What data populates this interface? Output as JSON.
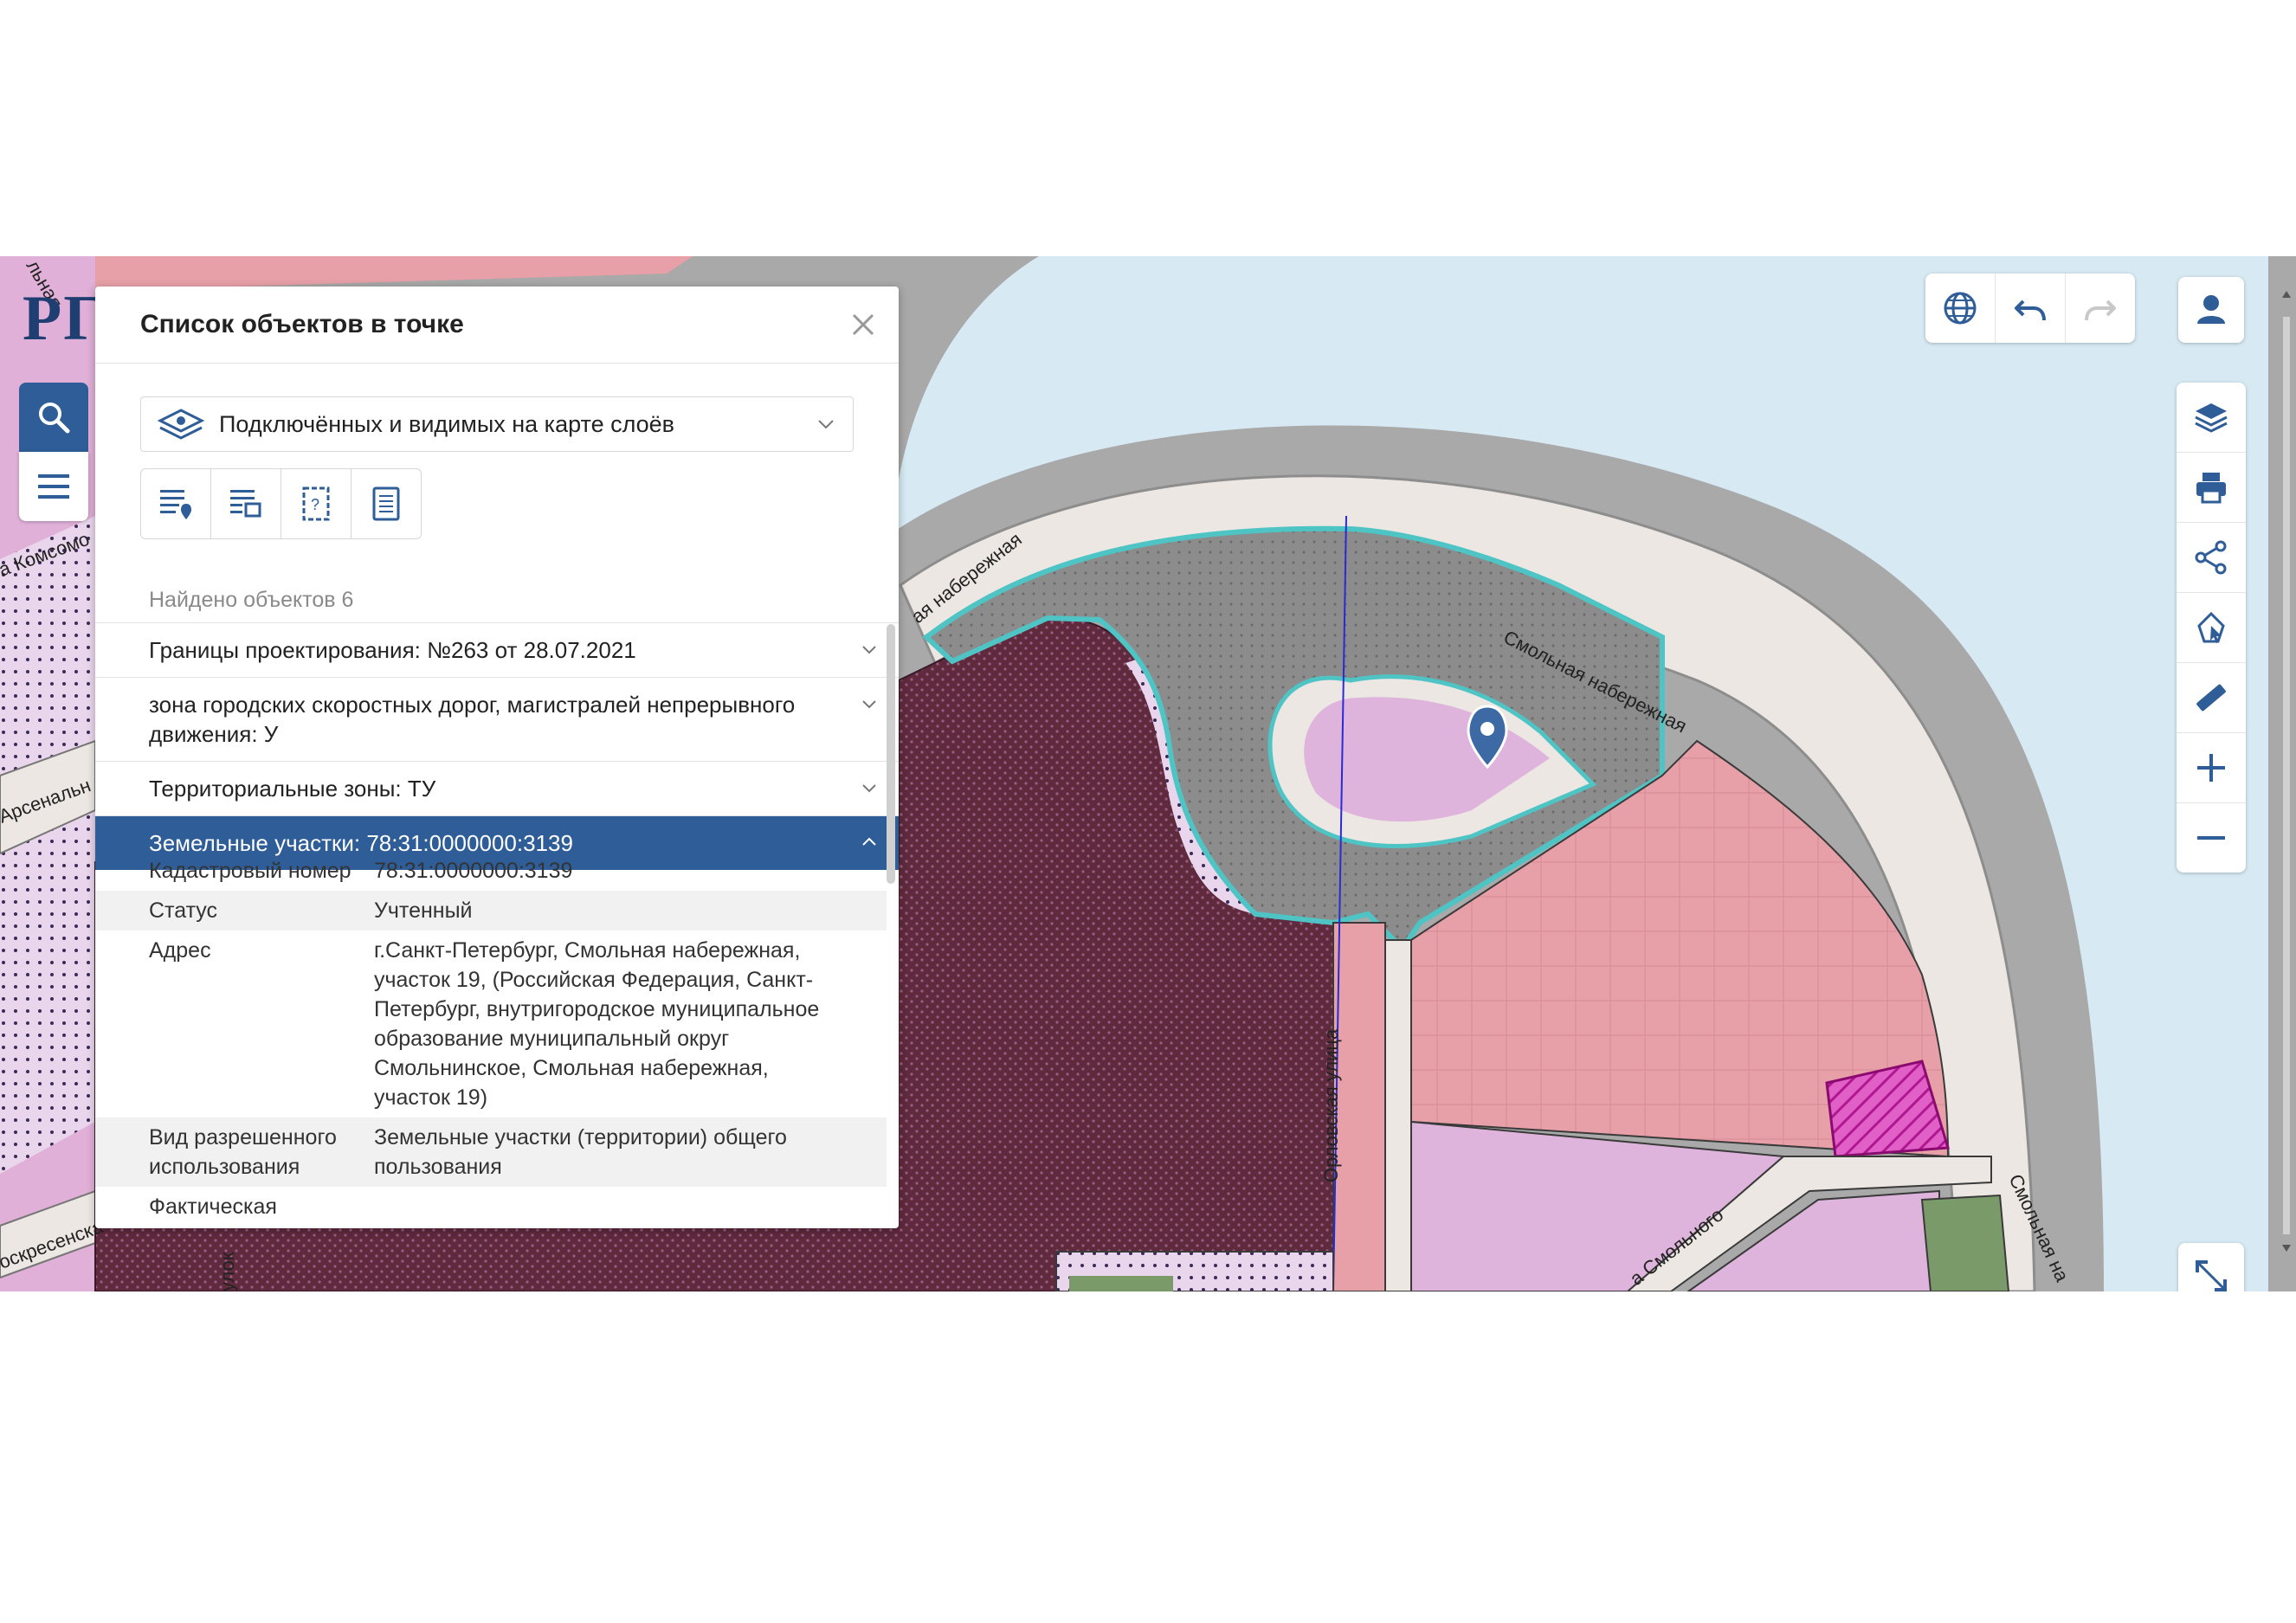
{
  "logo": "РГ",
  "panel": {
    "title": "Список объектов в точке",
    "layer_select": "Подключённых и видимых на карте слоёв",
    "found": "Найдено объектов 6",
    "results": [
      {
        "label": "Границы проектирования: №263 от 28.07.2021",
        "expanded": false
      },
      {
        "label": "зона городских скоростных дорог, магистралей непрерывного движения: У",
        "expanded": false
      },
      {
        "label": "Территориальные зоны: ТУ",
        "expanded": false
      },
      {
        "label": "Земельные участки: 78:31:0000000:3139",
        "expanded": true
      }
    ],
    "details": [
      {
        "key": "Кадастровый номер",
        "value": "78:31:0000000:3139"
      },
      {
        "key": "Статус",
        "value": "Учтенный"
      },
      {
        "key": "Адрес",
        "value": "г.Санкт-Петербург, Смольная набережная, участок 19, (Российская Федерация, Санкт-Петербург, внутригородское муниципальное образование муниципальный округ Смольнинское, Смольная набережная, участок 19)"
      },
      {
        "key": "Вид разрешенного использования",
        "value": "Земельные участки (территории) общего пользования"
      },
      {
        "key": "Фактическая",
        "value": ""
      }
    ]
  },
  "map": {
    "labels": {
      "smolnaya_1": "Смольная набережная",
      "smolnaya_2": "Смольная набережная",
      "smolnaya_3": "Смольная на",
      "smolnaya_top": "ая набережная",
      "orlovskaya": "Орловская улица",
      "smolnogo": "а Смольного",
      "komsomol": "а Комсомо",
      "arsenal": "Арсенальн",
      "voskres": "оскресенска",
      "pereulok": "улок",
      "top_left": "льная"
    },
    "colors": {
      "background": "#a9a9a9",
      "water": "#d7eaf4",
      "road": "#ece7e2",
      "pink": "#e8a0a8",
      "lilac": "#deb4dc",
      "maroon": "#5e2a3c",
      "gray_plot": "#888888",
      "highlight": "#4fc4c4",
      "accent": "#2e5d97"
    }
  },
  "icons": [
    "search-icon",
    "menu-icon",
    "globe-icon",
    "undo-icon",
    "redo-icon",
    "user-icon",
    "layers-icon",
    "print-icon",
    "share-icon",
    "map-select-icon",
    "ruler-icon",
    "zoom-in-icon",
    "zoom-out-icon",
    "fullscreen-icon",
    "close-icon",
    "chevron-down-icon",
    "chevron-up-icon",
    "eye-layers-icon",
    "list-marker-icon",
    "list-select-icon",
    "query-area-icon",
    "document-icon",
    "location-pin-icon"
  ]
}
